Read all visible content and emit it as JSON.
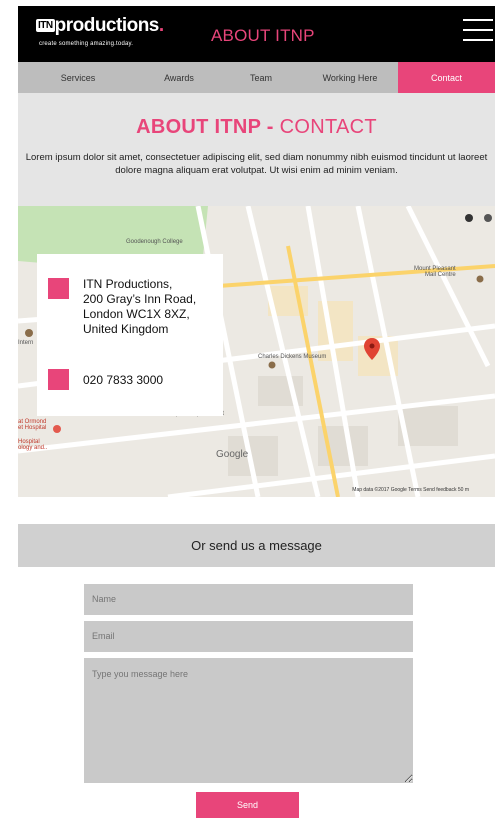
{
  "header": {
    "logo_mark": "ITN",
    "logo_word": "productions",
    "logo_dot": ".",
    "tagline": "create something amazing.today.",
    "title": "ABOUT ITNP"
  },
  "nav": {
    "items": [
      {
        "label": "Services"
      },
      {
        "label": "Awards"
      },
      {
        "label": "Team"
      },
      {
        "label": "Working Here"
      },
      {
        "label": "Contact"
      }
    ],
    "active": "Contact"
  },
  "intro": {
    "title_bold": "ABOUT ITNP -",
    "title_light": "CONTACT",
    "text": "Lorem ipsum dolor sit amet, consectetuer adipiscing elit, sed diam nonummy nibh euismod tincidunt ut laoreet dolore magna aliquam erat volutpat. Ut wisi enim ad minim veniam."
  },
  "map": {
    "address": [
      "ITN Productions,",
      "200 Gray’s Inn Road,",
      "London WC1X 8XZ,",
      "United Kingdom"
    ],
    "phone": "020 7833 3000",
    "labels": {
      "college": "Goodenough College",
      "museum": "Charles Dickens Museum",
      "mount_pleasant": "Mount Pleasant\nMail Centre",
      "supermarket": "The People’s Supermarket",
      "hospital": "at Ormond\net Hospital",
      "hospital2": "Hospital\nology and..",
      "intern": "Intern",
      "google": "Google"
    },
    "credit": "Map data ©2017 Google   Terms   Send feedback   50 m"
  },
  "message_band": "Or send us a message",
  "form": {
    "name_placeholder": "Name",
    "email_placeholder": "Email",
    "message_placeholder": "Type you message here",
    "send_label": "Send"
  },
  "colors": {
    "accent": "#e8457a",
    "header_bg": "#000000",
    "nav_bg": "#bdbdbd",
    "intro_bg": "#e5e5e5",
    "field_bg": "#c9c9c9"
  }
}
